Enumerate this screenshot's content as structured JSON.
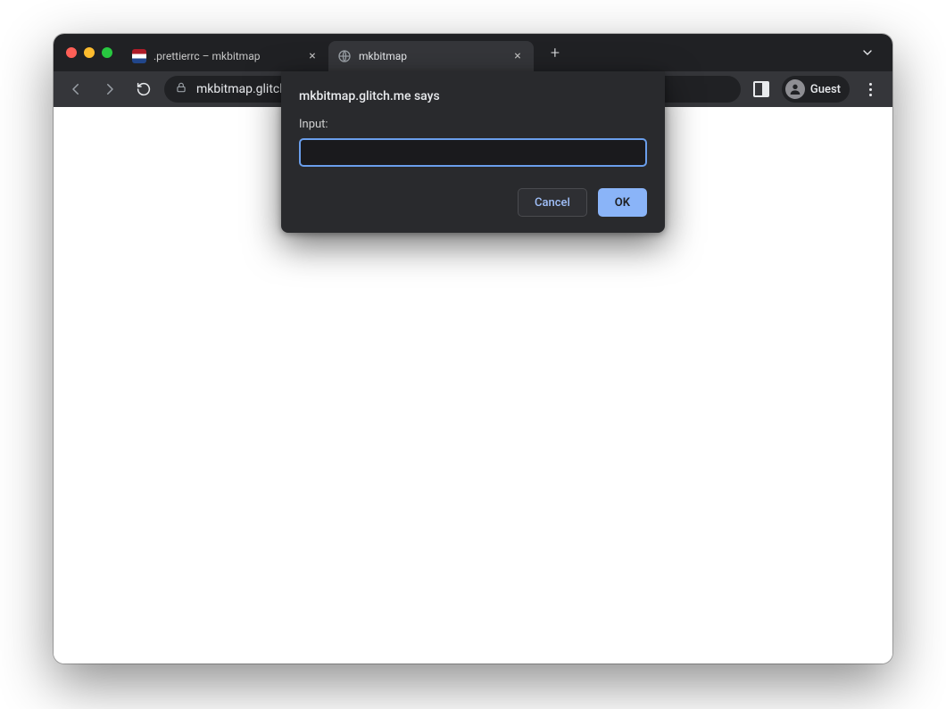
{
  "tabs": [
    {
      "label": ".prettierrc – mkbitmap",
      "active": false
    },
    {
      "label": "mkbitmap",
      "active": true
    }
  ],
  "addressbar": {
    "url_display": "mkbitmap.glitch.me"
  },
  "profile": {
    "label": "Guest"
  },
  "dialog": {
    "host_line": "mkbitmap.glitch.me says",
    "prompt_label": "Input:",
    "input_value": "",
    "buttons": {
      "cancel": "Cancel",
      "ok": "OK"
    }
  }
}
